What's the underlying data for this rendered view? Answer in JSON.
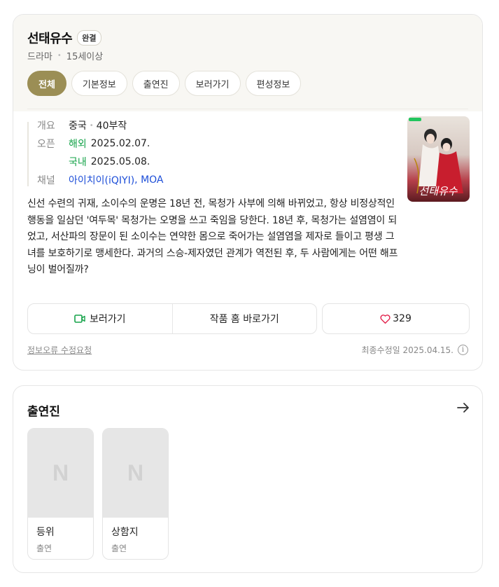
{
  "main": {
    "title": "선태유수",
    "badge": "완결",
    "genre": "드라마",
    "rating": "15세이상",
    "tabs": [
      {
        "label": "전체",
        "active": true
      },
      {
        "label": "기본정보",
        "active": false
      },
      {
        "label": "출연진",
        "active": false
      },
      {
        "label": "보러가기",
        "active": false
      },
      {
        "label": "편성정보",
        "active": false
      }
    ],
    "info": {
      "overview_label": "개요",
      "country": "중국",
      "episodes": "40부작",
      "open_label": "오픈",
      "overseas_label": "해외",
      "overseas_date": "2025.02.07.",
      "domestic_label": "국내",
      "domestic_date": "2025.05.08.",
      "channel_label": "채널",
      "channel_1": "아이치이(iQIYI)",
      "channel_sep": ",",
      "channel_2": "MOA"
    },
    "poster_text": "선태유수",
    "synopsis": "신선 수련의 귀재, 소이수의 운명은 18년 전, 목청가 사부에 의해 바뀌었고, 항상 비정상적인 행동을 일삼던 '여두목' 목청가는 오명을 쓰고 죽임을 당한다. 18년 후, 목청가는 설염염이 되었고, 서산파의 장문이 된 소이수는 연약한 몸으로 죽어가는 설염염을 제자로 들이고 평생 그녀를 보호하기로 맹세한다. 과거의 스승-제자였던 관계가 역전된 후, 두 사람에게는 어떤 해프닝이 벌어질까?",
    "actions": {
      "watch_label": "보러가기",
      "home_label": "작품 홈 바로가기",
      "like_count": "329"
    },
    "footer": {
      "report_label": "정보오류 수정요청",
      "updated_label": "최종수정일 2025.04.15.",
      "info_icon_text": "i"
    }
  },
  "cast": {
    "title": "출연진",
    "placeholder_letter": "N",
    "members": [
      {
        "name": "등위",
        "role": "출연"
      },
      {
        "name": "상함지",
        "role": "출연"
      }
    ]
  },
  "colors": {
    "accent": "#9b8e55",
    "green": "#16a34a",
    "blue": "#1d4ed8",
    "heart": "#e11d48"
  }
}
